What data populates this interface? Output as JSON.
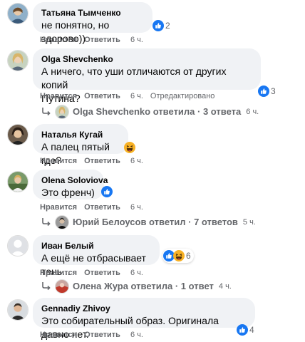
{
  "colors": {
    "bubble": "#f0f2f5",
    "secondary_text": "#65676b",
    "like_blue": "#1877f2",
    "haha_yellow": "#f7b125"
  },
  "comments": [
    {
      "author": "Татьяна Тымченко",
      "text": "не понятно, но здорово))",
      "like": "Нравится",
      "reply": "Ответить",
      "time": "6 ч.",
      "reactions": [
        "like-icon"
      ],
      "reaction_count": "2"
    },
    {
      "author": "Olga Shevchenko",
      "text_line1": "А ничего, что уши отличаются от других копий",
      "text_line2": "Путина?",
      "like": "Нравится",
      "reply": "Ответить",
      "time": "6 ч.",
      "edited": "Отредактировано",
      "reactions": [
        "like-icon"
      ],
      "reaction_count": "3",
      "replies": {
        "text": "Olga Shevchenko ответила · 3 ответа",
        "time": "6 ч."
      }
    },
    {
      "author": "Наталья Кугай",
      "text": "А палец пятый где?",
      "like": "Нравится",
      "reply": "Ответить",
      "time": "6 ч.",
      "reactions": [
        "haha-icon"
      ]
    },
    {
      "author": "Olena Soloviova",
      "text": "Это френч)",
      "like": "Нравится",
      "reply": "Ответить",
      "time": "6 ч.",
      "reactions": [
        "like-icon"
      ],
      "replies": {
        "text": "Юрий Белоусов ответил · 7 ответов",
        "time": "5 ч."
      }
    },
    {
      "author": "Иван Белый",
      "text": "А ещё не отбрасывает тень...",
      "like": "Нравится",
      "reply": "Ответить",
      "time": "6 ч.",
      "reactions": [
        "like-icon",
        "haha-icon"
      ],
      "reaction_count": "6",
      "replies": {
        "text": "Олена Жура ответила · 1 ответ",
        "time": "4 ч."
      }
    },
    {
      "author": "Gennadiy Zhivoy",
      "text": "Это собирательный образ. Оригинала давно нет.",
      "like": "Нравится",
      "reply": "Ответить",
      "time": "6 ч.",
      "reactions": [
        "like-icon"
      ],
      "reaction_count": "4"
    }
  ]
}
